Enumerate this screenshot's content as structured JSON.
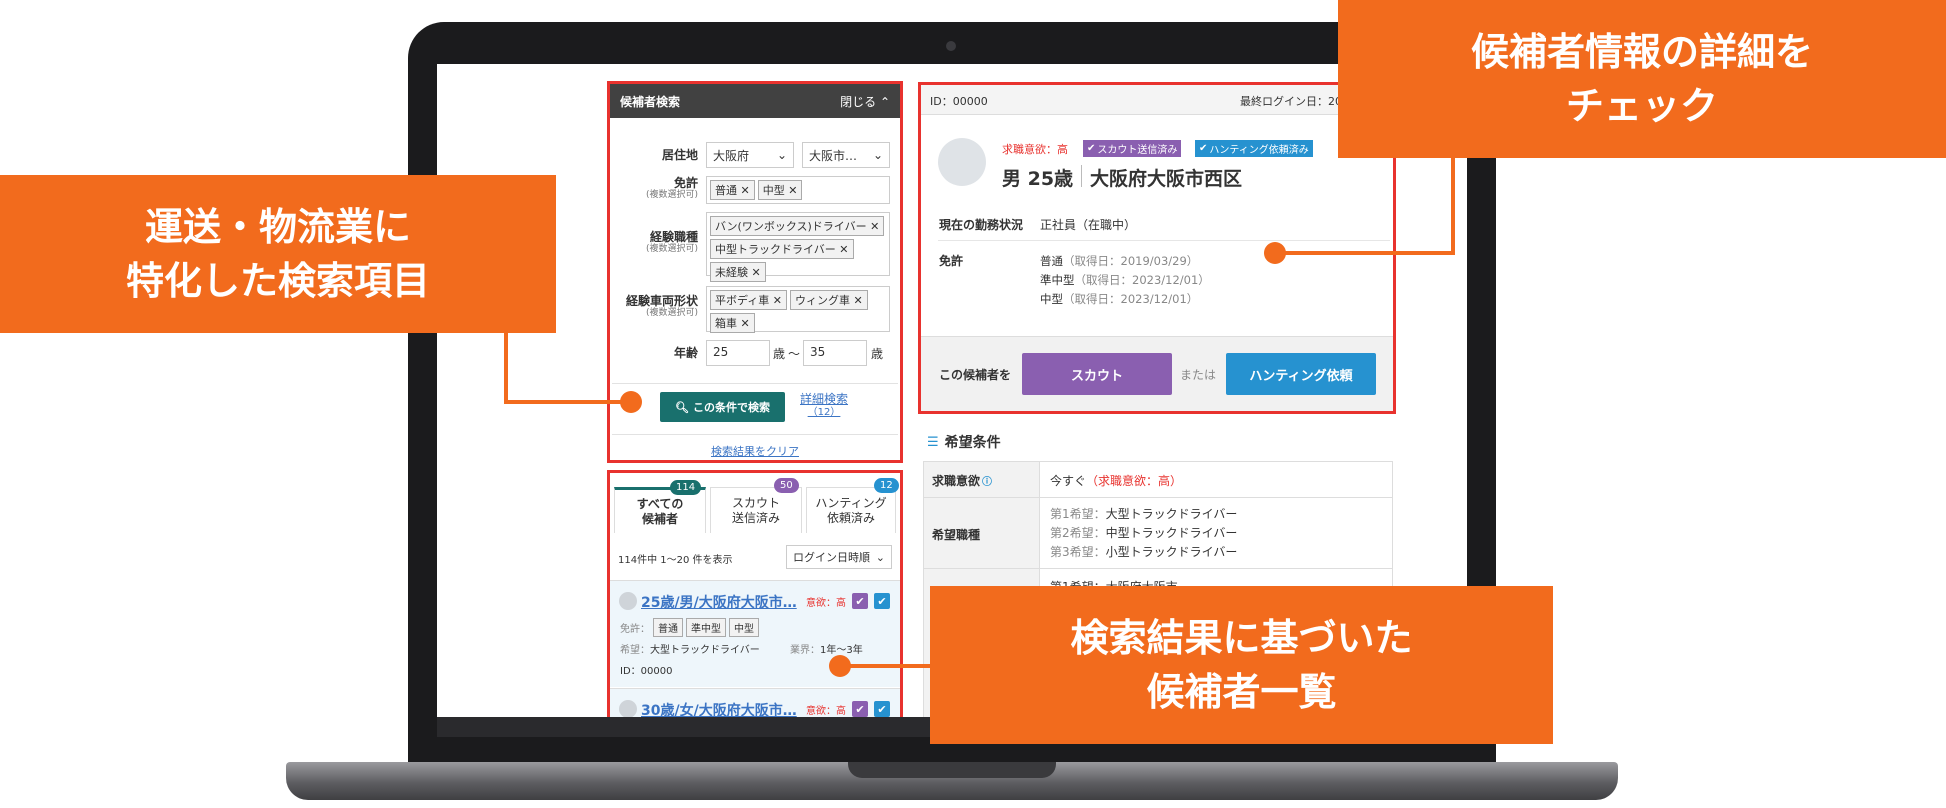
{
  "callouts": {
    "left_line1": "運送・物流業に",
    "left_line2": "特化した検索項目",
    "topright_line1": "候補者情報の詳細を",
    "topright_line2": "チェック",
    "bottom_line1": "検索結果に基づいた",
    "bottom_line2": "候補者一覧"
  },
  "search": {
    "title": "候補者検索",
    "close_label": "閉じる",
    "residence_label": "居住地",
    "prefecture": "大阪府",
    "city": "大阪市…",
    "license_label": "免許",
    "license_sub": "(複数選択可)",
    "license_tags": [
      "普通",
      "中型"
    ],
    "job_label": "経験職種",
    "job_sub": "(複数選択可)",
    "job_tags": [
      "バン(ワンボックス)ドライバー",
      "中型トラックドライバー",
      "未経験"
    ],
    "vehicle_label": "経験車両形状",
    "vehicle_sub": "(複数選択可)",
    "vehicle_tags": [
      "平ボディ車",
      "ウィング車",
      "箱車"
    ],
    "age_label": "年齢",
    "age_from": "25",
    "age_unit": "歳",
    "tilde": "〜",
    "age_to": "35",
    "search_button": "この条件で検索",
    "advanced_link": "詳細検索",
    "advanced_count": "（12）",
    "clear_link": "検索結果をクリア"
  },
  "results": {
    "tabs": [
      {
        "label1": "すべての",
        "label2": "候補者",
        "count": "114"
      },
      {
        "label1": "スカウト",
        "label2": "送信済み",
        "count": "50"
      },
      {
        "label1": "ハンティング",
        "label2": "依頼済み",
        "count": "12"
      }
    ],
    "summary": "114件中 1～20 件を表示",
    "sort": "ログイン日時順",
    "items": [
      {
        "title": "25歳/男/大阪府大阪市…",
        "motivation": "意欲：高",
        "license_label": "免許：",
        "licenses": [
          "普通",
          "準中型",
          "中型"
        ],
        "wish_label": "希望：",
        "wish": "大型トラックドライバー",
        "industry_label": "業界：",
        "industry": "1年〜3年",
        "id": "ID：00000"
      },
      {
        "title": "30歳/女/大阪府大阪市…",
        "motivation": "意欲：高"
      }
    ]
  },
  "detail": {
    "id": "ID：00000",
    "last_login": "最終ログイン日：20",
    "motivation": "求職意欲：高",
    "badge_scout": "スカウト送信済み",
    "badge_hunting": "ハンティング依頼済み",
    "gender_age": "男 25歳",
    "location": "大阪府大阪市西区",
    "status_label": "現在の勤務状況",
    "status_value": "正社員（在職中）",
    "license_label": "免許",
    "licenses": [
      {
        "name": "普通",
        "date": "（取得日：2019/03/29）"
      },
      {
        "name": "準中型",
        "date": "（取得日：2023/12/01）"
      },
      {
        "name": "中型",
        "date": "（取得日：2023/12/01）"
      }
    ],
    "action_label": "この候補者を",
    "scout_button": "スカウト",
    "or_label": "または",
    "hunting_button": "ハンティング依頼"
  },
  "wish": {
    "heading": "希望条件",
    "motivation_label": "求職意欲",
    "motivation_value": "今すぐ",
    "motivation_paren": "（求職意欲：高）",
    "job_label": "希望職種",
    "jobs": [
      {
        "rank": "第1希望：",
        "value": "大型トラックドライバー"
      },
      {
        "rank": "第2希望：",
        "value": "中型トラックドライバー"
      },
      {
        "rank": "第3希望：",
        "value": "小型トラックドライバー"
      }
    ],
    "partial_row": "第1希望：大阪府大阪市"
  },
  "colors": {
    "accent_orange": "#f26b1d",
    "highlight_red": "#e8322e",
    "teal": "#19706d",
    "scout_purple": "#8a5fb0",
    "hunting_blue": "#2692d0"
  }
}
